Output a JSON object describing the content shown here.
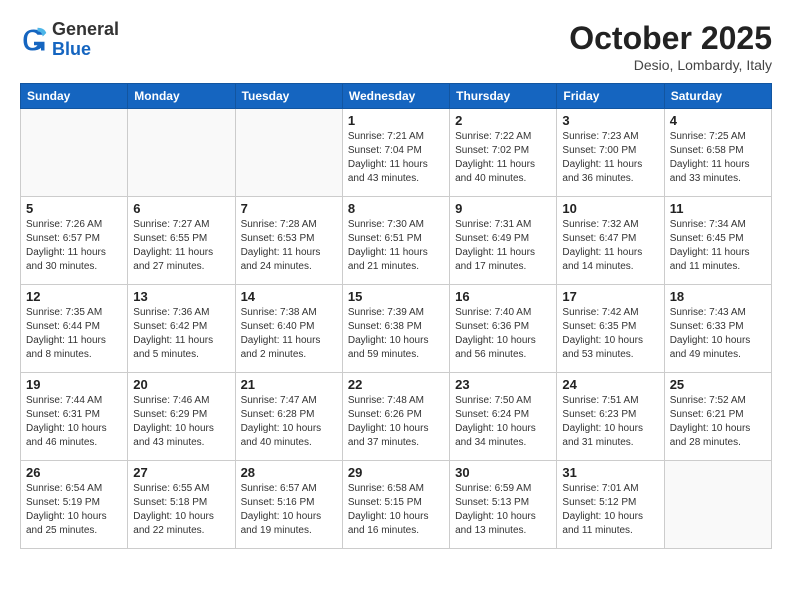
{
  "logo": {
    "general": "General",
    "blue": "Blue"
  },
  "header": {
    "month": "October 2025",
    "location": "Desio, Lombardy, Italy"
  },
  "days_of_week": [
    "Sunday",
    "Monday",
    "Tuesday",
    "Wednesday",
    "Thursday",
    "Friday",
    "Saturday"
  ],
  "weeks": [
    [
      {
        "day": "",
        "info": ""
      },
      {
        "day": "",
        "info": ""
      },
      {
        "day": "",
        "info": ""
      },
      {
        "day": "1",
        "info": "Sunrise: 7:21 AM\nSunset: 7:04 PM\nDaylight: 11 hours\nand 43 minutes."
      },
      {
        "day": "2",
        "info": "Sunrise: 7:22 AM\nSunset: 7:02 PM\nDaylight: 11 hours\nand 40 minutes."
      },
      {
        "day": "3",
        "info": "Sunrise: 7:23 AM\nSunset: 7:00 PM\nDaylight: 11 hours\nand 36 minutes."
      },
      {
        "day": "4",
        "info": "Sunrise: 7:25 AM\nSunset: 6:58 PM\nDaylight: 11 hours\nand 33 minutes."
      }
    ],
    [
      {
        "day": "5",
        "info": "Sunrise: 7:26 AM\nSunset: 6:57 PM\nDaylight: 11 hours\nand 30 minutes."
      },
      {
        "day": "6",
        "info": "Sunrise: 7:27 AM\nSunset: 6:55 PM\nDaylight: 11 hours\nand 27 minutes."
      },
      {
        "day": "7",
        "info": "Sunrise: 7:28 AM\nSunset: 6:53 PM\nDaylight: 11 hours\nand 24 minutes."
      },
      {
        "day": "8",
        "info": "Sunrise: 7:30 AM\nSunset: 6:51 PM\nDaylight: 11 hours\nand 21 minutes."
      },
      {
        "day": "9",
        "info": "Sunrise: 7:31 AM\nSunset: 6:49 PM\nDaylight: 11 hours\nand 17 minutes."
      },
      {
        "day": "10",
        "info": "Sunrise: 7:32 AM\nSunset: 6:47 PM\nDaylight: 11 hours\nand 14 minutes."
      },
      {
        "day": "11",
        "info": "Sunrise: 7:34 AM\nSunset: 6:45 PM\nDaylight: 11 hours\nand 11 minutes."
      }
    ],
    [
      {
        "day": "12",
        "info": "Sunrise: 7:35 AM\nSunset: 6:44 PM\nDaylight: 11 hours\nand 8 minutes."
      },
      {
        "day": "13",
        "info": "Sunrise: 7:36 AM\nSunset: 6:42 PM\nDaylight: 11 hours\nand 5 minutes."
      },
      {
        "day": "14",
        "info": "Sunrise: 7:38 AM\nSunset: 6:40 PM\nDaylight: 11 hours\nand 2 minutes."
      },
      {
        "day": "15",
        "info": "Sunrise: 7:39 AM\nSunset: 6:38 PM\nDaylight: 10 hours\nand 59 minutes."
      },
      {
        "day": "16",
        "info": "Sunrise: 7:40 AM\nSunset: 6:36 PM\nDaylight: 10 hours\nand 56 minutes."
      },
      {
        "day": "17",
        "info": "Sunrise: 7:42 AM\nSunset: 6:35 PM\nDaylight: 10 hours\nand 53 minutes."
      },
      {
        "day": "18",
        "info": "Sunrise: 7:43 AM\nSunset: 6:33 PM\nDaylight: 10 hours\nand 49 minutes."
      }
    ],
    [
      {
        "day": "19",
        "info": "Sunrise: 7:44 AM\nSunset: 6:31 PM\nDaylight: 10 hours\nand 46 minutes."
      },
      {
        "day": "20",
        "info": "Sunrise: 7:46 AM\nSunset: 6:29 PM\nDaylight: 10 hours\nand 43 minutes."
      },
      {
        "day": "21",
        "info": "Sunrise: 7:47 AM\nSunset: 6:28 PM\nDaylight: 10 hours\nand 40 minutes."
      },
      {
        "day": "22",
        "info": "Sunrise: 7:48 AM\nSunset: 6:26 PM\nDaylight: 10 hours\nand 37 minutes."
      },
      {
        "day": "23",
        "info": "Sunrise: 7:50 AM\nSunset: 6:24 PM\nDaylight: 10 hours\nand 34 minutes."
      },
      {
        "day": "24",
        "info": "Sunrise: 7:51 AM\nSunset: 6:23 PM\nDaylight: 10 hours\nand 31 minutes."
      },
      {
        "day": "25",
        "info": "Sunrise: 7:52 AM\nSunset: 6:21 PM\nDaylight: 10 hours\nand 28 minutes."
      }
    ],
    [
      {
        "day": "26",
        "info": "Sunrise: 6:54 AM\nSunset: 5:19 PM\nDaylight: 10 hours\nand 25 minutes."
      },
      {
        "day": "27",
        "info": "Sunrise: 6:55 AM\nSunset: 5:18 PM\nDaylight: 10 hours\nand 22 minutes."
      },
      {
        "day": "28",
        "info": "Sunrise: 6:57 AM\nSunset: 5:16 PM\nDaylight: 10 hours\nand 19 minutes."
      },
      {
        "day": "29",
        "info": "Sunrise: 6:58 AM\nSunset: 5:15 PM\nDaylight: 10 hours\nand 16 minutes."
      },
      {
        "day": "30",
        "info": "Sunrise: 6:59 AM\nSunset: 5:13 PM\nDaylight: 10 hours\nand 13 minutes."
      },
      {
        "day": "31",
        "info": "Sunrise: 7:01 AM\nSunset: 5:12 PM\nDaylight: 10 hours\nand 11 minutes."
      },
      {
        "day": "",
        "info": ""
      }
    ]
  ]
}
